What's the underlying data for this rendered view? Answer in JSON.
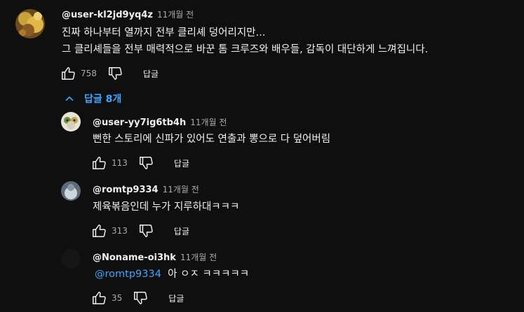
{
  "comment": {
    "handle": "@user-kl2jd9yq4z",
    "time": "11개월 전",
    "line1": "진짜 하나부터 열까지 전부 클리셰 덩어리지만...",
    "line2": "그 클리셰들을 전부 매력적으로 바꾼 톰 크루즈와 배우들, 감독이 대단하게 느껴집니다.",
    "likes": "758",
    "reply_label": "답글"
  },
  "replies_toggle": {
    "label": "답글 8개"
  },
  "replies": [
    {
      "handle": "@user-yy7ig6tb4h",
      "time": "11개월 전",
      "text": "뻔한 스토리에 신파가 있어도 연출과 뽕으로 다 덮어버림",
      "likes": "113",
      "reply_label": "답글"
    },
    {
      "handle": "@romtp9334",
      "time": "11개월 전",
      "text": "제육볶음인데 누가 지루하대ㅋㅋㅋ",
      "likes": "313",
      "reply_label": "답글"
    },
    {
      "handle": "@Noname-oi3hk",
      "time": "11개월 전",
      "mention": "@romtp9334",
      "text": "아 ㅇㅈ ㅋㅋㅋㅋㅋ",
      "likes": "35",
      "reply_label": "답글"
    }
  ],
  "icons": {
    "like": "thumbs-up-icon",
    "dislike": "thumbs-down-icon",
    "chevron": "chevron-up-icon"
  },
  "colors": {
    "background": "#0f0f0f",
    "text": "#f1f1f1",
    "secondary": "#aaaaaa",
    "link": "#3ea6ff"
  }
}
